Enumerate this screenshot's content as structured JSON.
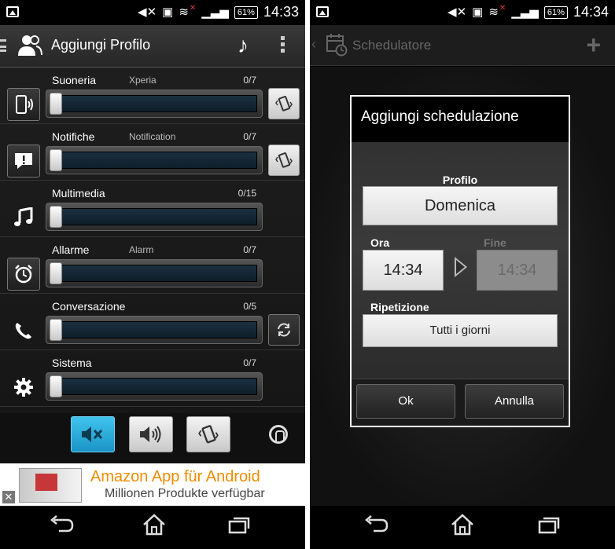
{
  "left": {
    "status": {
      "battery": "61%",
      "time": "14:33"
    },
    "appbar": {
      "title": "Aggiungi Profilo"
    },
    "rows": [
      {
        "label": "Suoneria",
        "mid": "Xperia",
        "count": "0/7"
      },
      {
        "label": "Notifiche",
        "mid": "Notification",
        "count": "0/7"
      },
      {
        "label": "Multimedia",
        "mid": "",
        "count": "0/15"
      },
      {
        "label": "Allarme",
        "mid": "Alarm",
        "count": "0/7"
      },
      {
        "label": "Conversazione",
        "mid": "",
        "count": "0/5"
      },
      {
        "label": "Sistema",
        "mid": "",
        "count": "0/7"
      }
    ],
    "ad": {
      "title": "Amazon App für Android",
      "subtitle": "Millionen Produkte verfügbar",
      "close": "✕"
    }
  },
  "right": {
    "status": {
      "battery": "61%",
      "time": "14:34"
    },
    "appbar": {
      "title": "Schedulatore"
    },
    "dialog": {
      "title": "Aggiungi schedulazione",
      "profile_label": "Profilo",
      "profile_value": "Domenica",
      "start_label": "Ora",
      "start_value": "14:34",
      "end_label": "Fine",
      "end_value": "14:34",
      "repeat_label": "Ripetizione",
      "repeat_value": "Tutti i giorni",
      "ok": "Ok",
      "cancel": "Annulla"
    }
  },
  "icons": {
    "mute": "🔇",
    "volume": "🔊",
    "vibrate": "📳",
    "note": "♪",
    "phone": "📞",
    "gear": "⚙",
    "alarm": "⏰",
    "sync": "⟳",
    "back": "↶",
    "home": "⌂",
    "recents": "▭",
    "plus": "+",
    "calendar": "📅",
    "ring": "◯"
  }
}
